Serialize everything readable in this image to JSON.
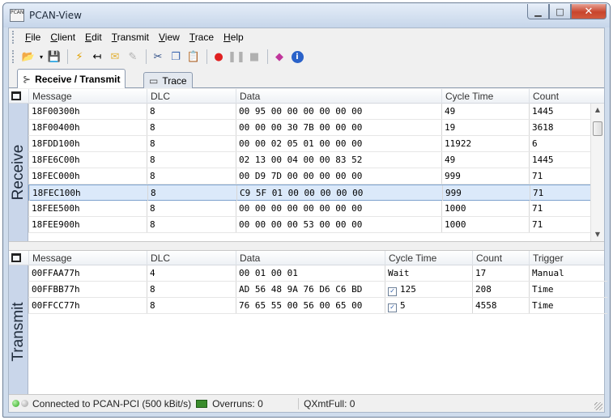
{
  "window": {
    "title": "PCAN-View",
    "app_icon_label": "PCAN"
  },
  "menu": [
    "File",
    "Client",
    "Edit",
    "Transmit",
    "View",
    "Trace",
    "Help"
  ],
  "menu_access_keys": [
    "F",
    "C",
    "E",
    "T",
    "V",
    "T",
    "H"
  ],
  "tabs": [
    {
      "label": "Receive / Transmit",
      "active": true
    },
    {
      "label": "Trace",
      "active": false
    }
  ],
  "receive": {
    "side_label": "Receive",
    "headers": [
      "Message",
      "DLC",
      "Data",
      "Cycle Time",
      "Count"
    ],
    "rows": [
      [
        "18F00300h",
        "8",
        "00 95 00 00 00 00 00 00",
        "49",
        "1445"
      ],
      [
        "18F00400h",
        "8",
        "00 00 00 30 7B 00 00 00",
        "19",
        "3618"
      ],
      [
        "18FDD100h",
        "8",
        "00 00 02 05 01 00 00 00",
        "11922",
        "6"
      ],
      [
        "18FE6C00h",
        "8",
        "02 13 00 04 00 00 83 52",
        "49",
        "1445"
      ],
      [
        "18FEC000h",
        "8",
        "00 D9 7D 00 00 00 00 00",
        "999",
        "71"
      ],
      [
        "18FEC100h",
        "8",
        "C9 5F 01 00 00 00 00 00",
        "999",
        "71"
      ],
      [
        "18FEE500h",
        "8",
        "00 00 00 00 00 00 00 00",
        "1000",
        "71"
      ],
      [
        "18FEE900h",
        "8",
        "00 00 00 00 53 00 00 00",
        "1000",
        "71"
      ]
    ],
    "selected_row": 5
  },
  "transmit": {
    "side_label": "Transmit",
    "headers": [
      "Message",
      "DLC",
      "Data",
      "Cycle Time",
      "Count",
      "Trigger"
    ],
    "rows": [
      {
        "message": "00FFAA77h",
        "dlc": "4",
        "data": "00 01 00 01",
        "cycle": "Wait",
        "checked": false,
        "count": "17",
        "trigger": "Manual"
      },
      {
        "message": "00FFBB77h",
        "dlc": "8",
        "data": "AD 56 48 9A 76 D6 C6 BD",
        "cycle": "125",
        "checked": true,
        "count": "208",
        "trigger": "Time"
      },
      {
        "message": "00FFCC77h",
        "dlc": "8",
        "data": "76 65 55 00 56 00 65 00",
        "cycle": "5",
        "checked": true,
        "count": "4558",
        "trigger": "Time"
      }
    ]
  },
  "status": {
    "connection": "Connected to PCAN-PCI (500 kBit/s)",
    "overruns": "Overruns: 0",
    "qxmtfull": "QXmtFull: 0"
  },
  "colors": {
    "selection": "#dbe9fa",
    "sidebar": "#c9d6ea",
    "record": "#e02020",
    "info": "#2a62c9"
  }
}
